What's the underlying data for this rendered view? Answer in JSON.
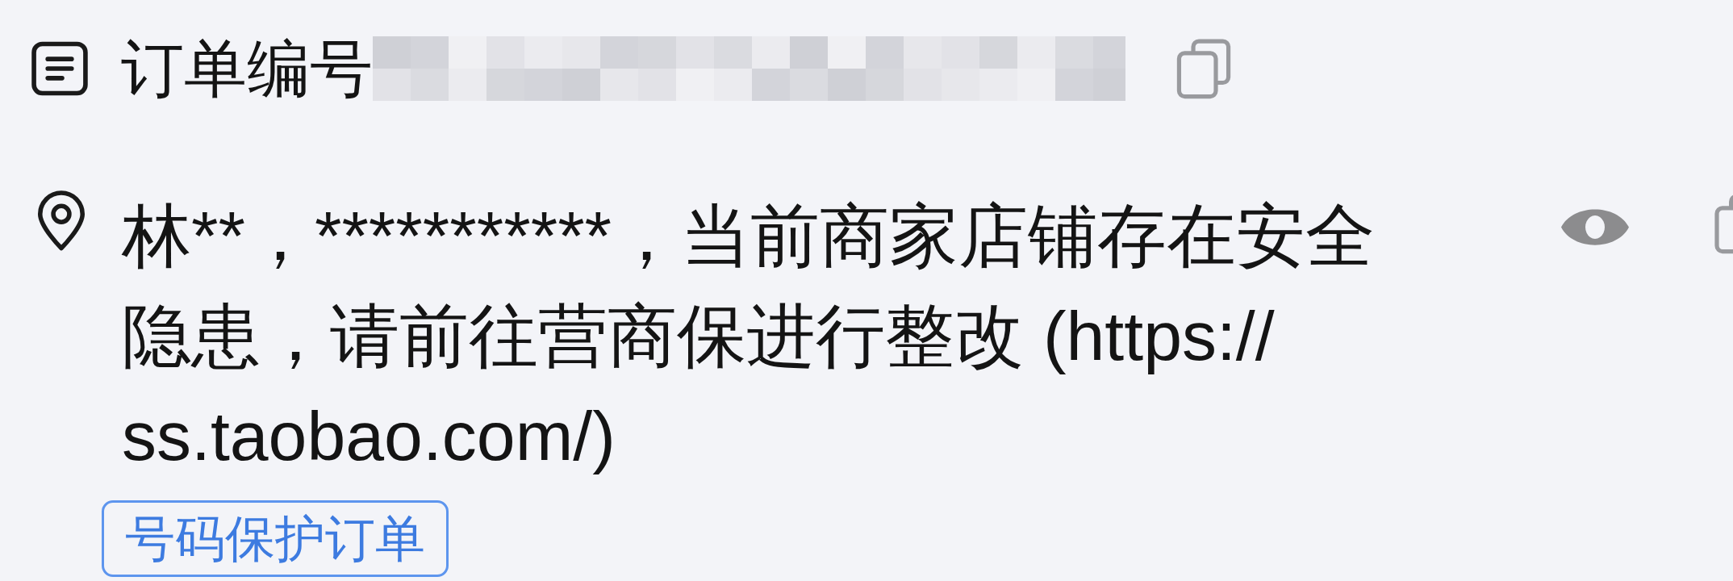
{
  "order": {
    "label": "订单编号"
  },
  "address": {
    "text": "林**，***********，当前商家店铺存在安全隐患，请前往营商保进行整改 (https://ss.taobao.com/)",
    "tag": "号码保护订单"
  }
}
